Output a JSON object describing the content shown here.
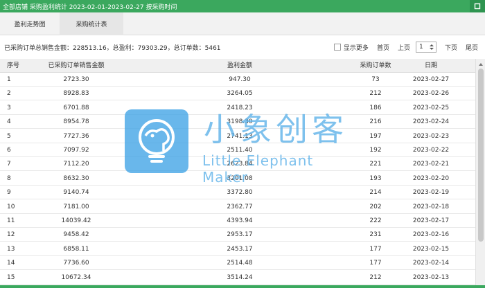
{
  "window": {
    "title": "全部店铺 采购盈利统计 2023-02-01-2023-02-27 按采购时间"
  },
  "tabs": [
    {
      "label": "盈利走势图"
    },
    {
      "label": "采购统计表"
    }
  ],
  "summary": {
    "text": "已采购订单总销售金额：228513.16，总盈利：79303.29，总订单数：5461"
  },
  "pager": {
    "show_more": "显示更多",
    "first": "首页",
    "prev": "上页",
    "page": "1",
    "next": "下页",
    "last": "尾页"
  },
  "table": {
    "headers": [
      "序号",
      "已采购订单销售金额",
      "盈利金额",
      "采购订单数",
      "日期"
    ],
    "rows": [
      {
        "idx": "1",
        "sales": "2723.30",
        "profit": "947.30",
        "orders": "73",
        "date": "2023-02-27"
      },
      {
        "idx": "2",
        "sales": "8928.83",
        "profit": "3264.05",
        "orders": "212",
        "date": "2023-02-26"
      },
      {
        "idx": "3",
        "sales": "6701.88",
        "profit": "2418.23",
        "orders": "186",
        "date": "2023-02-25"
      },
      {
        "idx": "4",
        "sales": "8954.78",
        "profit": "3198.30",
        "orders": "216",
        "date": "2023-02-24"
      },
      {
        "idx": "5",
        "sales": "7727.36",
        "profit": "2741.13",
        "orders": "197",
        "date": "2023-02-23"
      },
      {
        "idx": "6",
        "sales": "7097.92",
        "profit": "2511.40",
        "orders": "192",
        "date": "2023-02-22"
      },
      {
        "idx": "7",
        "sales": "7112.20",
        "profit": "2623.84",
        "orders": "221",
        "date": "2023-02-21"
      },
      {
        "idx": "8",
        "sales": "8632.30",
        "profit": "3201.08",
        "orders": "193",
        "date": "2023-02-20"
      },
      {
        "idx": "9",
        "sales": "9140.74",
        "profit": "3372.80",
        "orders": "214",
        "date": "2023-02-19"
      },
      {
        "idx": "10",
        "sales": "7181.00",
        "profit": "2362.77",
        "orders": "202",
        "date": "2023-02-18"
      },
      {
        "idx": "11",
        "sales": "14039.42",
        "profit": "4393.94",
        "orders": "222",
        "date": "2023-02-17"
      },
      {
        "idx": "12",
        "sales": "9458.42",
        "profit": "2953.17",
        "orders": "231",
        "date": "2023-02-16"
      },
      {
        "idx": "13",
        "sales": "6858.11",
        "profit": "2453.17",
        "orders": "177",
        "date": "2023-02-15"
      },
      {
        "idx": "14",
        "sales": "7736.60",
        "profit": "2514.48",
        "orders": "177",
        "date": "2023-02-14"
      },
      {
        "idx": "15",
        "sales": "10672.34",
        "profit": "3514.24",
        "orders": "212",
        "date": "2023-02-13"
      }
    ]
  },
  "watermark": {
    "cn": "小象创客",
    "en": "Little Elephant Maker"
  },
  "colors": {
    "accent": "#3ba85e",
    "watermark": "#3fa4e6"
  },
  "icons": {
    "close": "close-icon",
    "logo": "elephant-logo-icon"
  }
}
